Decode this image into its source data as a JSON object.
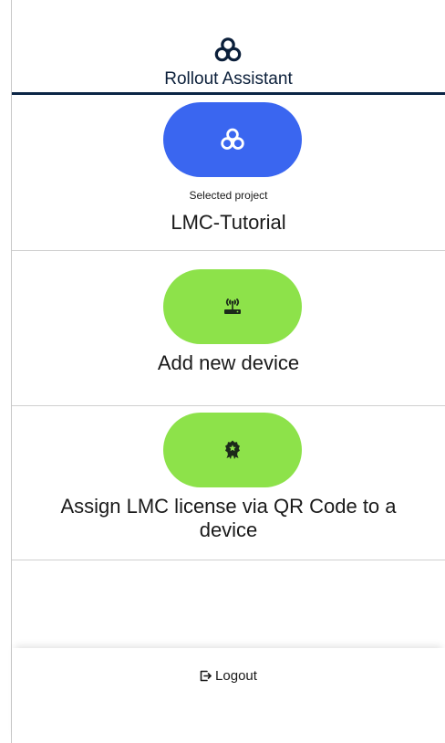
{
  "header": {
    "title": "Rollout Assistant",
    "logo_icon": "cloud-network-icon"
  },
  "project": {
    "button_icon": "cloud-network-icon",
    "caption": "Selected project",
    "name": "LMC-Tutorial",
    "color": "#3a66f0"
  },
  "add_device": {
    "button_icon": "router-wireless-icon",
    "label": "Add new device",
    "color": "#8de24a"
  },
  "assign_license": {
    "button_icon": "certificate-badge-icon",
    "label": "Assign LMC license via QR Code to a device",
    "color": "#8de24a"
  },
  "footer": {
    "logout_icon": "logout-icon",
    "logout_label": "Logout"
  }
}
